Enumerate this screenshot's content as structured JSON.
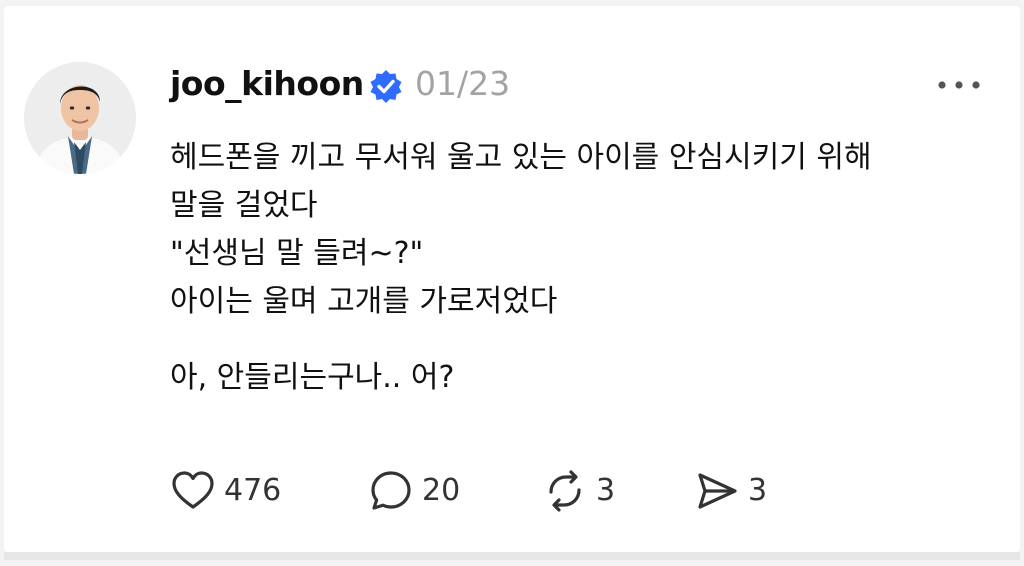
{
  "post": {
    "username": "joo_kihoon",
    "verified_icon": "verified-badge-icon",
    "date": "01/23",
    "more_icon": "more-options-icon",
    "avatar_icon": "profile-avatar"
  },
  "content": {
    "lines": [
      "헤드폰을 끼고 무서워 울고 있는 아이를 안심시키기 위해",
      "말을 걸었다",
      "\"선생님 말 들려~?\"",
      "아이는 울며 고개를 가로저었다",
      "아, 안들리는구나.. 어?"
    ]
  },
  "actions": {
    "like": {
      "icon": "heart-icon",
      "count": "476"
    },
    "reply": {
      "icon": "comment-icon",
      "count": "20"
    },
    "repost": {
      "icon": "repost-icon",
      "count": "3"
    },
    "share": {
      "icon": "send-icon",
      "count": "3"
    }
  },
  "colors": {
    "text": "#111111",
    "muted": "#a3a3a3",
    "verified": "#2f6bff",
    "icon": "#333333"
  }
}
